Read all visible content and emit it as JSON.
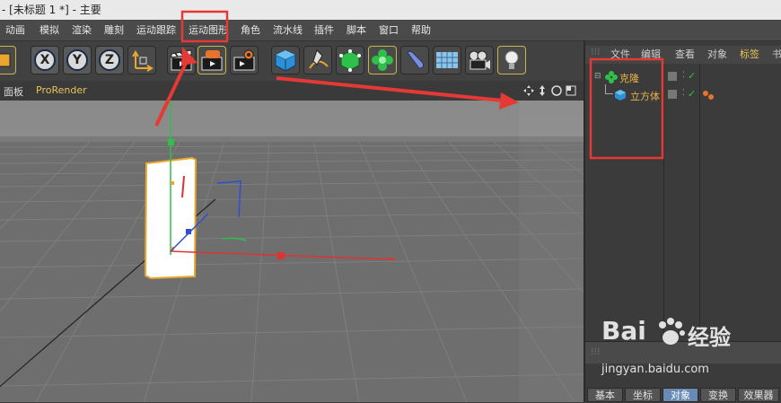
{
  "window": {
    "title": "- [未标题 1 *] - 主要"
  },
  "menu": [
    "动画",
    "模拟",
    "渲染",
    "雕刻",
    "运动跟踪",
    "运动图形",
    "角色",
    "流水线",
    "插件",
    "脚本",
    "窗口",
    "帮助"
  ],
  "toolbar": {
    "axis_x": "X",
    "axis_y": "Y",
    "axis_z": "Z"
  },
  "viewport": {
    "menu_panel": "面板",
    "menu_prorender": "ProRender"
  },
  "object_manager": {
    "tabs": [
      "文件",
      "编辑",
      "查看",
      "对象",
      "标签",
      "书"
    ],
    "items": [
      {
        "label": "克隆"
      },
      {
        "label": "立方体"
      }
    ]
  },
  "attributes": {
    "tabs": [
      "基本",
      "坐标",
      "对象",
      "变换",
      "效果器"
    ],
    "active_tab": "对象"
  },
  "watermark": {
    "brand": "Bai",
    "brand2": "经验",
    "url": "jingyan.baidu.com"
  },
  "colors": {
    "highlight_box": "#e53935",
    "accent_orange": "#e8b34a",
    "active_tab": "#6a8ab6"
  }
}
